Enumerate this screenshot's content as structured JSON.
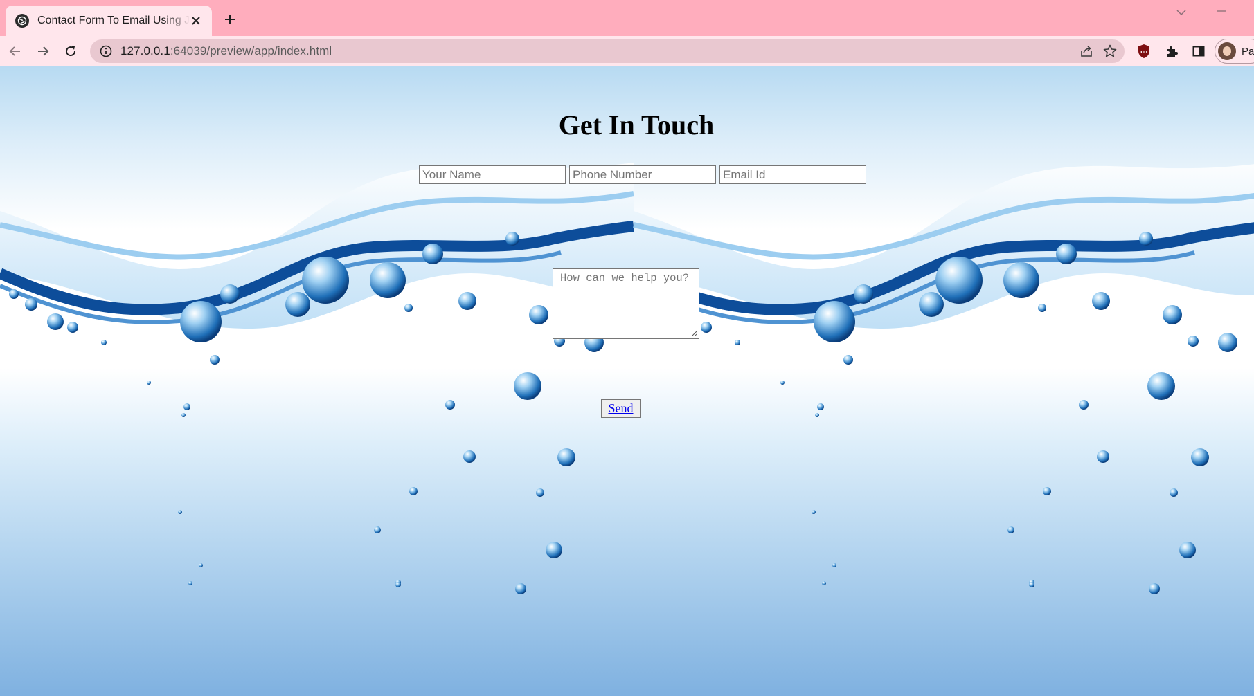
{
  "browser": {
    "tab_title": "Contact Form To Email Using JavaScript",
    "url_host": "127.0.0.1",
    "url_rest": ":64039/preview/app/index.html",
    "profile_label": "Pa"
  },
  "page": {
    "heading": "Get In Touch",
    "name_placeholder": "Your Name",
    "phone_placeholder": "Phone Number",
    "email_placeholder": "Email Id",
    "message_placeholder": "How can we help you?",
    "send_label": "Send"
  },
  "colors": {
    "tabstrip": "#ffadbd",
    "toolbar": "#ffe6ec",
    "omnibox": "#e9c8d0",
    "link": "#0000ee"
  },
  "icons": [
    "globe-icon",
    "close-icon",
    "plus-icon",
    "chevron-down-icon",
    "minimize-icon",
    "back-arrow-icon",
    "forward-arrow-icon",
    "reload-icon",
    "info-icon",
    "share-icon",
    "star-icon",
    "shield-extension-icon",
    "puzzle-icon",
    "side-panel-icon"
  ]
}
